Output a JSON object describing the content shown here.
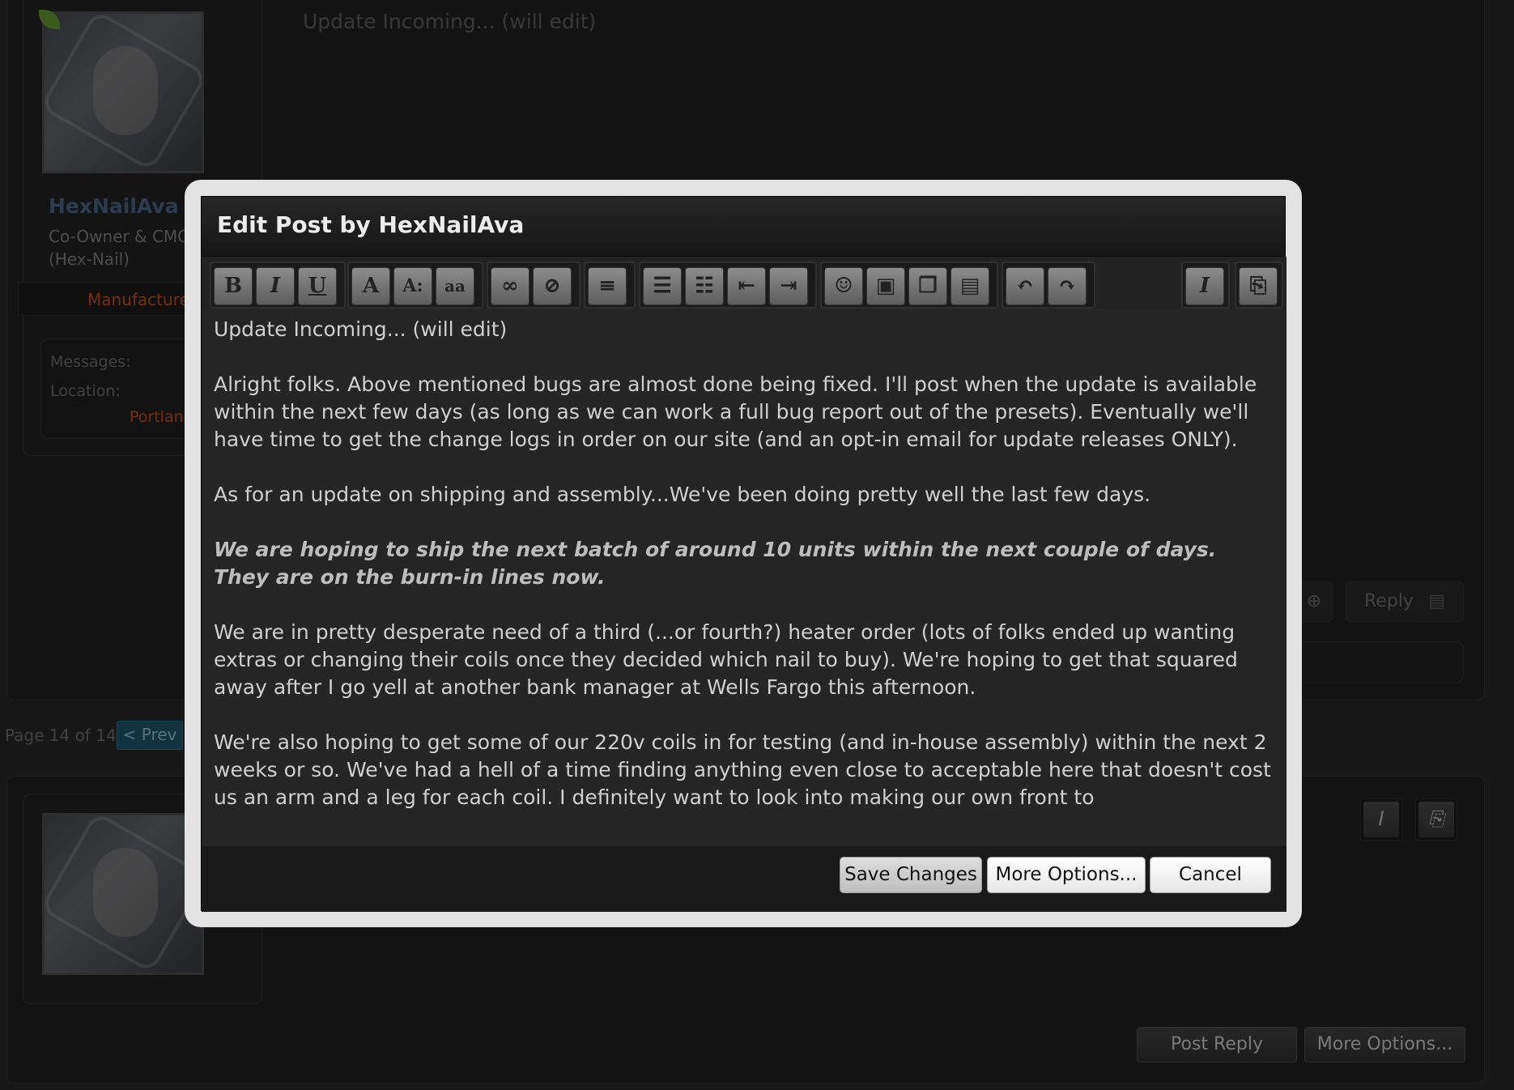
{
  "background_post": {
    "title": "Update Incoming... (will edit)",
    "author": {
      "name": "HexNailAva",
      "title_line1": "Co-Owner & CMO",
      "title_line2": "(Hex-Nail)",
      "badge": "Manufacturer",
      "messages_label": "Messages:",
      "location_label": "Location:",
      "location_value": "Portland"
    },
    "reply_label": "Reply"
  },
  "pager": {
    "label": "Page 14 of 14",
    "prev_label": "< Prev"
  },
  "quick_reply": {
    "post_reply_label": "Post Reply",
    "more_options_label": "More Options...",
    "icons": [
      "remove-format-icon",
      "switch-mode-icon"
    ]
  },
  "modal": {
    "title": "Edit Post by HexNailAva",
    "toolbar": {
      "groups": [
        [
          "bold-icon",
          "italic-icon",
          "underline-icon"
        ],
        [
          "text-color-icon",
          "font-size-icon",
          "font-family-icon"
        ],
        [
          "link-icon",
          "unlink-icon"
        ],
        [
          "align-icon"
        ],
        [
          "bulleted-list-icon",
          "numbered-list-icon",
          "outdent-icon",
          "indent-icon"
        ],
        [
          "smilie-icon",
          "image-icon",
          "media-icon",
          "insert-code-icon"
        ],
        [
          "undo-icon",
          "redo-icon"
        ],
        [
          "remove-format-icon"
        ],
        [
          "switch-mode-icon"
        ]
      ],
      "glyphs": {
        "bold": "B",
        "italic": "I",
        "underline": "U",
        "text_color": "A",
        "font_size": "A:",
        "font_family": "aa"
      }
    },
    "paragraphs": [
      "Update Incoming... (will edit)",
      "Alright folks. Above mentioned bugs are almost done being fixed. I'll post when the update is available within the next few days (as long as we can work a full bug report out of the presets). Eventually we'll have time to get the change logs in order on our site (and an opt-in email for update releases ONLY).",
      "As for an update on shipping and assembly...We've been doing pretty well the last few days.",
      "We are hoping to ship the next batch of around 10 units within the next couple of days. They are on the burn-in lines now.",
      "We are in pretty desperate need of a third (...or fourth?) heater order (lots of folks ended up wanting extras or changing their coils once they decided which nail to buy). We're hoping to get that squared away after I go yell at another bank manager at Wells Fargo this afternoon.",
      "We're also hoping to get some of our 220v coils in for testing (and in-house assembly) within the next 2 weeks or so. We've had a hell of a time finding anything even close to acceptable here that doesn't cost us an arm and a leg for each coil. I definitely want to look into making our own front to"
    ],
    "buttons": {
      "save": "Save Changes",
      "more_options": "More Options...",
      "cancel": "Cancel"
    }
  }
}
